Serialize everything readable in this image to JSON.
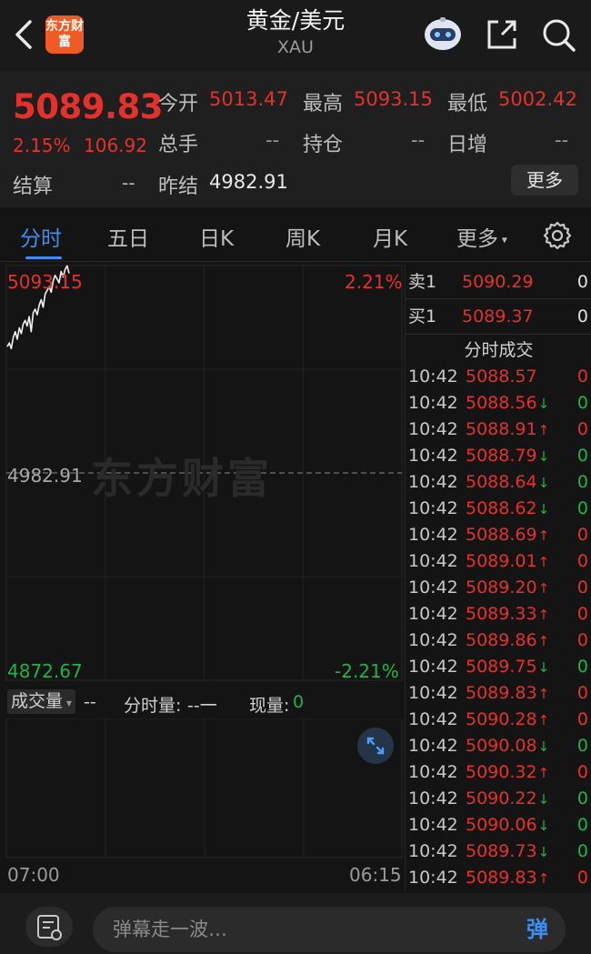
{
  "header": {
    "logo_text": "东方财富",
    "title": "黄金/美元",
    "subtitle": "XAU"
  },
  "quote": {
    "price": "5089.83",
    "change_pct": "2.15%",
    "change_abs": "106.92",
    "settle_label": "结算",
    "settle_value": "--",
    "fields": [
      {
        "label": "今开",
        "value": "5013.47"
      },
      {
        "label": "最高",
        "value": "5093.15"
      },
      {
        "label": "最低",
        "value": "5002.42"
      },
      {
        "label": "总手",
        "value": "--"
      },
      {
        "label": "持仓",
        "value": "--"
      },
      {
        "label": "日增",
        "value": "--"
      },
      {
        "label": "昨结",
        "value": "4982.91"
      }
    ],
    "more_label": "更多"
  },
  "tabs": [
    {
      "label": "分时"
    },
    {
      "label": "五日"
    },
    {
      "label": "日K"
    },
    {
      "label": "周K"
    },
    {
      "label": "月K"
    },
    {
      "label": "更多"
    }
  ],
  "chart": {
    "high_label": "5093.15",
    "high_pct": "2.21%",
    "ref_label": "4982.91",
    "low_label": "4872.67",
    "low_pct": "-2.21%",
    "watermark": "东方财富",
    "start_time": "07:00",
    "end_time": "06:15"
  },
  "chart_data": {
    "type": "line",
    "ylim": [
      4872.67,
      5093.15
    ],
    "reference": 4982.91,
    "series": [
      {
        "values": [
          5050,
          5052,
          5049,
          5055,
          5058,
          5054,
          5060,
          5057,
          5062,
          5064,
          5061,
          5066,
          5058,
          5068,
          5070,
          5067,
          5072,
          5075,
          5071,
          5078,
          5080,
          5082,
          5079,
          5085,
          5088,
          5086,
          5084,
          5090,
          5087,
          5091,
          5093,
          5089
        ]
      }
    ]
  },
  "volume": {
    "selector": "成交量",
    "selector_val": "--",
    "fenshi_label": "分时量:",
    "fenshi_val": "--一",
    "xianliang_label": "现量:",
    "xianliang_val": "0"
  },
  "orderbook": [
    {
      "key": "卖1",
      "price": "5090.29",
      "qty": "0"
    },
    {
      "key": "买1",
      "price": "5089.37",
      "qty": "0"
    }
  ],
  "trades_title": "分时成交",
  "trades": [
    {
      "time": "10:42",
      "price": "5088.57",
      "arrow": "",
      "vol": "0",
      "color": "red"
    },
    {
      "time": "10:42",
      "price": "5088.56",
      "arrow": "↓",
      "vol": "0",
      "color": "green"
    },
    {
      "time": "10:42",
      "price": "5088.91",
      "arrow": "↑",
      "vol": "0",
      "color": "red"
    },
    {
      "time": "10:42",
      "price": "5088.79",
      "arrow": "↓",
      "vol": "0",
      "color": "green"
    },
    {
      "time": "10:42",
      "price": "5088.64",
      "arrow": "↓",
      "vol": "0",
      "color": "green"
    },
    {
      "time": "10:42",
      "price": "5088.62",
      "arrow": "↓",
      "vol": "0",
      "color": "green"
    },
    {
      "time": "10:42",
      "price": "5088.69",
      "arrow": "↑",
      "vol": "0",
      "color": "red"
    },
    {
      "time": "10:42",
      "price": "5089.01",
      "arrow": "↑",
      "vol": "0",
      "color": "red"
    },
    {
      "time": "10:42",
      "price": "5089.20",
      "arrow": "↑",
      "vol": "0",
      "color": "red"
    },
    {
      "time": "10:42",
      "price": "5089.33",
      "arrow": "↑",
      "vol": "0",
      "color": "red"
    },
    {
      "time": "10:42",
      "price": "5089.86",
      "arrow": "↑",
      "vol": "0",
      "color": "red"
    },
    {
      "time": "10:42",
      "price": "5089.75",
      "arrow": "↓",
      "vol": "0",
      "color": "green"
    },
    {
      "time": "10:42",
      "price": "5089.83",
      "arrow": "↑",
      "vol": "0",
      "color": "red"
    },
    {
      "time": "10:42",
      "price": "5090.28",
      "arrow": "↑",
      "vol": "0",
      "color": "red"
    },
    {
      "time": "10:42",
      "price": "5090.08",
      "arrow": "↓",
      "vol": "0",
      "color": "green"
    },
    {
      "time": "10:42",
      "price": "5090.32",
      "arrow": "↑",
      "vol": "0",
      "color": "red"
    },
    {
      "time": "10:42",
      "price": "5090.22",
      "arrow": "↓",
      "vol": "0",
      "color": "green"
    },
    {
      "time": "10:42",
      "price": "5090.06",
      "arrow": "↓",
      "vol": "0",
      "color": "green"
    },
    {
      "time": "10:42",
      "price": "5089.73",
      "arrow": "↓",
      "vol": "0",
      "color": "green"
    },
    {
      "time": "10:42",
      "price": "5089.83",
      "arrow": "↑",
      "vol": "0",
      "color": "red"
    }
  ],
  "bottom": {
    "placeholder": "弹幕走一波…",
    "danmu_label": "弹"
  },
  "colors": {
    "up": "#e4312b",
    "down": "#1fb24a",
    "accent": "#3d8ef0",
    "background": "#141414"
  }
}
